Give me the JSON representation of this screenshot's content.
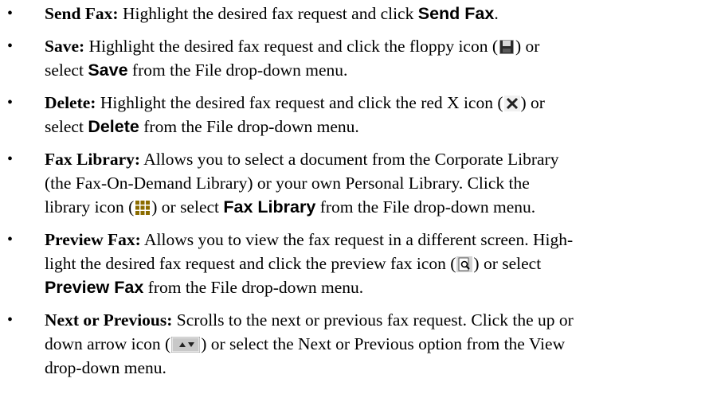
{
  "items": [
    {
      "term": "Send Fax:",
      "text_1": " Highlight the desired fax request and click ",
      "ui_1": "Send Fax",
      "text_2": "."
    },
    {
      "term": "Save:",
      "text_1": " Highlight the desired fax request and click the floppy icon (",
      "icon": "floppy-icon",
      "text_2": ") or",
      "text_3": "select ",
      "ui_1": "Save",
      "text_4": " from the File drop-down menu."
    },
    {
      "term": "Delete:",
      "text_1": " Highlight the desired fax request and click the red X icon (",
      "icon": "delete-x-icon",
      "text_2": ") or",
      "text_3": "select ",
      "ui_1": "Delete",
      "text_4": " from the File drop-down menu."
    },
    {
      "term": "Fax Library:",
      "text_1": " Allows you to select a document from the Corporate Library",
      "line_2": "(the Fax-On-Demand Library) or your own Personal Library. Click the",
      "text_3": "library icon (",
      "icon": "library-icon",
      "text_4": ") or select ",
      "ui_1": "Fax Library",
      "text_5": " from the File drop-down menu."
    },
    {
      "term": "Preview Fax:",
      "text_1": " Allows you to view the fax request in a different screen. High-",
      "line_2a": "light the desired fax request and click the preview fax icon (",
      "icon": "preview-fax-icon",
      "line_2b": ") or select",
      "ui_1": "Preview Fax",
      "text_3": " from the File drop-down menu."
    },
    {
      "term": "Next or Previous:",
      "text_1": " Scrolls to the next or previous fax request. Click the up or",
      "line_2a": "down arrow icon (",
      "icon": "up-down-arrow-icon",
      "line_2b": ") or select the Next or Previous option from the View",
      "line_3": "drop-down menu."
    }
  ],
  "colors": {
    "text": "#000000",
    "floppy_icon": "#2a2a2a",
    "delete_icon": "#c00000",
    "library_icon": "#8b6c00",
    "arrow_button_bg": "#c8c8c8"
  }
}
